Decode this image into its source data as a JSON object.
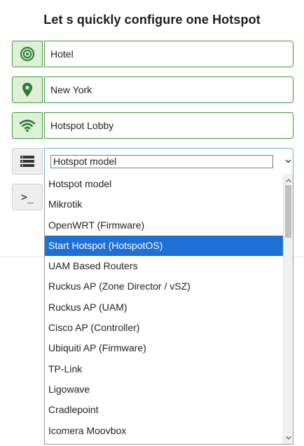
{
  "title": "Let s quickly configure one Hotspot",
  "fields": {
    "venue_type": "Hotel",
    "location": "New York",
    "hotspot_name": "Hotspot Lobby"
  },
  "model_select": {
    "selected": "Hotspot model",
    "options": [
      "Hotspot model",
      "Mikrotik",
      "OpenWRT (Firmware)",
      "Start Hotspot (HotspotOS)",
      "UAM Based Routers",
      "Ruckus AP (Zone Director / vSZ)",
      "Ruckus AP (UAM)",
      "Cisco AP (Controller)",
      "Ubiquiti AP (Firmware)",
      "TP-Link",
      "Ligowave",
      "Cradlepoint",
      "Icomera Moovbox"
    ],
    "highlighted": "Start Hotspot (HotspotOS)"
  },
  "command_button": ">_",
  "icons": {
    "venue": "target-icon",
    "location": "map-pin-icon",
    "hotspot": "wifi-icon",
    "model": "server-stack-icon",
    "command": "terminal-icon"
  },
  "colors": {
    "accent_green": "#3f9a3a",
    "addon_bg": "#dff0d8",
    "highlight_blue": "#1e6fd6"
  }
}
